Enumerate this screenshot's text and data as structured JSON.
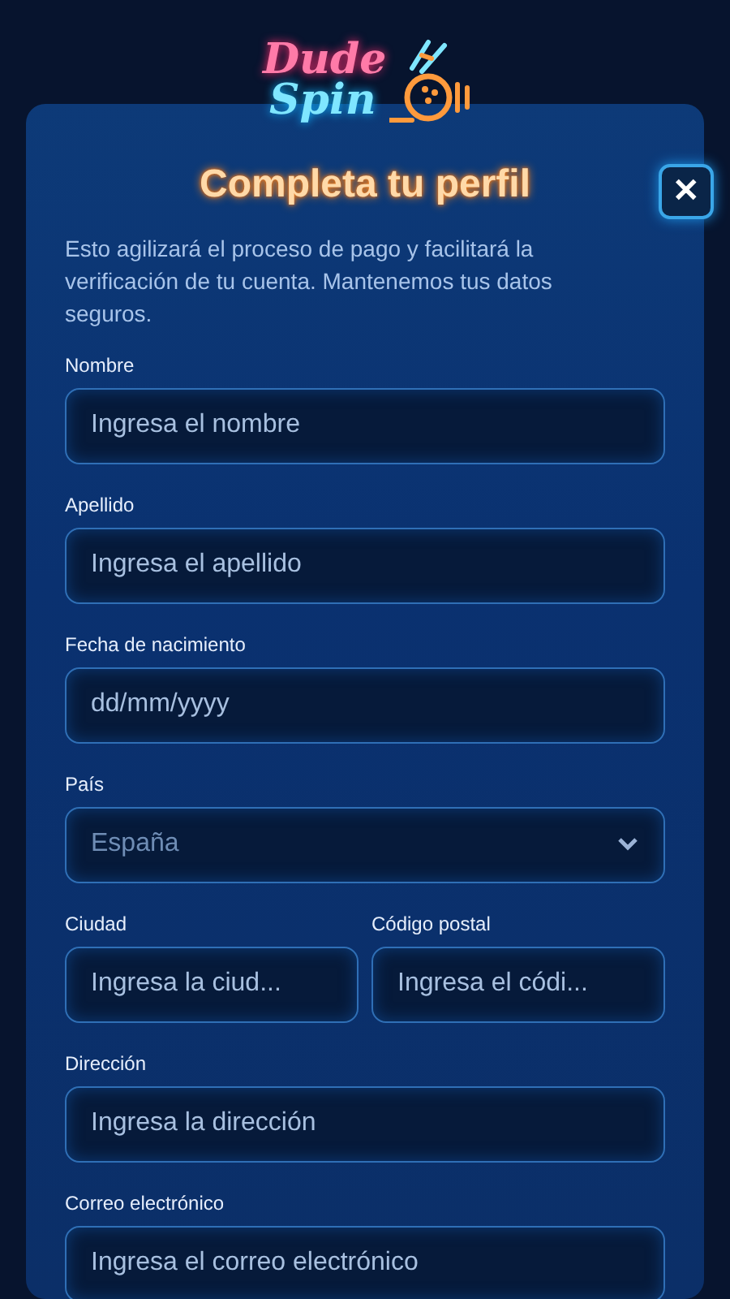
{
  "logo": {
    "lines": [
      "Dude",
      "Spin"
    ]
  },
  "modal": {
    "title": "Completa tu perfil",
    "close_label": "✕",
    "description": "Esto agilizará el proceso de pago y facilitará la verificación de tu cuenta. Mantenemos tus datos seguros."
  },
  "rows": [
    {
      "fields": [
        {
          "kind": "input",
          "label": "Nombre",
          "placeholder": "Ingresa el nombre"
        }
      ]
    },
    {
      "fields": [
        {
          "kind": "input",
          "label": "Apellido",
          "placeholder": "Ingresa el apellido"
        }
      ]
    },
    {
      "fields": [
        {
          "kind": "input",
          "label": "Fecha de nacimiento",
          "placeholder": "dd/mm/yyyy"
        }
      ]
    },
    {
      "fields": [
        {
          "kind": "select",
          "label": "País",
          "value": "España"
        }
      ]
    },
    {
      "fields": [
        {
          "kind": "input",
          "label": "Ciudad",
          "placeholder": "Ingresa la ciud..."
        },
        {
          "kind": "input",
          "label": "Código postal",
          "placeholder": "Ingresa el códi..."
        }
      ]
    },
    {
      "fields": [
        {
          "kind": "input",
          "label": "Dirección",
          "placeholder": "Ingresa la dirección"
        }
      ]
    },
    {
      "fields": [
        {
          "kind": "input",
          "label": "Correo electrónico",
          "placeholder": "Ingresa el correo electrónico"
        }
      ]
    }
  ]
}
